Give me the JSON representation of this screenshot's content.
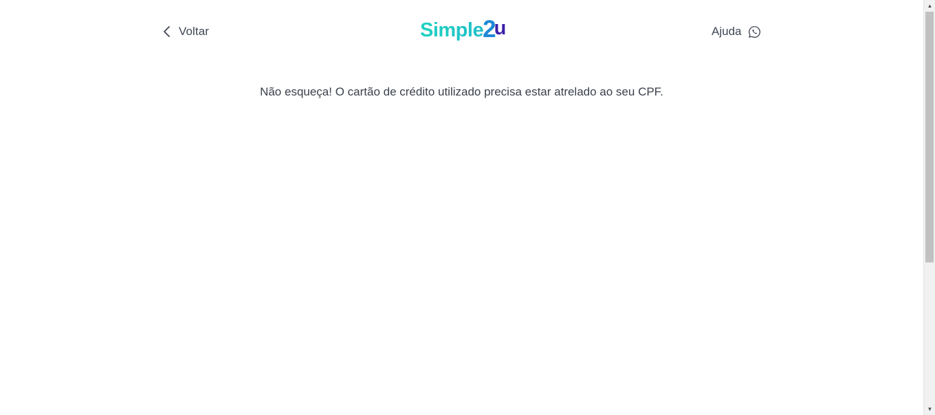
{
  "header": {
    "back_label": "Voltar",
    "back_icon": "chevron-left-icon",
    "logo": {
      "part_simple": "Simple",
      "part_two": "2",
      "part_u": "u",
      "colors": {
        "simple": "#1fd1c1",
        "two": "#1e88d6",
        "u": "#3b1fa8"
      }
    },
    "help_label": "Ajuda",
    "help_icon": "whatsapp-icon"
  },
  "main": {
    "notice": "Não esqueça! O cartão de crédito utilizado precisa estar atrelado ao seu CPF."
  },
  "scrollbar": {
    "up_glyph": "▲",
    "down_glyph": "▼"
  },
  "colors": {
    "text": "#3a3f4a",
    "background": "#ffffff",
    "scroll_thumb": "#c1c1c1"
  }
}
